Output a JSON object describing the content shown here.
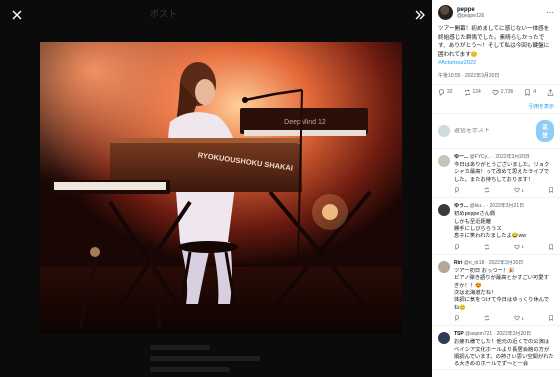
{
  "viewer": {
    "close_icon": "close-icon",
    "expand_icon": "chevron-double-right-icon",
    "ghost_tab_label": "ポスト"
  },
  "photo": {
    "banner_text": "RYOKUOUSHOKU SHAKAI",
    "keyboard_label": "DeepMind 12"
  },
  "post": {
    "display_name": "peppe",
    "handle": "@peppe126",
    "body": "ツアー開幕！初めましてに感じない一体感を終始感じた群馬でした。素晴らしかったです、ありがとう〜！そして私は今回も鍵盤に囲われてます😊",
    "hashtag": "#Actortour2022",
    "timestamp": "午後10:55 · 2022年3月20日",
    "stats": {
      "replies": "32",
      "reposts": "124",
      "likes": "2,736",
      "bookmarks": "4"
    },
    "related_link": "引用を表示"
  },
  "reply_box": {
    "placeholder": "返信をポスト",
    "button_label": "返信"
  },
  "replies": [
    {
      "name": "ゆー...",
      "handle": "@FYCy...",
      "date": "· 2022年3月20日",
      "text": "今日はありがとうございました。リョクシャカ最高！って改めて思えたライブでした。またお待ちしております！",
      "actions": {
        "reply": "",
        "repost": "",
        "like": "1",
        "views": ""
      },
      "avatar_color": "#c9c2b8"
    },
    {
      "name": "ゆう...",
      "handle": "@kiu...",
      "date": "· 2022年3月21日",
      "text": "初めpeppeさん側\nしかも至近距離\n勝手にしびららうス\n息子に笑われたましたよ😂ww",
      "actions": {
        "reply": "",
        "repost": "",
        "like": "1",
        "views": ""
      },
      "avatar_color": "#3d3a36"
    },
    {
      "name": "Riri",
      "handle": "@ri_rir18",
      "date": "· 2022年3月20日",
      "text": "ツアー初日 おっつー！🎉\nピアノ弾き語りが最高とかすごい可愛すぎか！！😍\n次は北海道だね！\n体調に気をつけて今日はゆっくり休んでね😊",
      "actions": {
        "reply": "",
        "repost": "",
        "like": "1",
        "views": ""
      },
      "avatar_color": "#b6a79b"
    },
    {
      "name": "TSP",
      "handle": "@aspon721",
      "date": "· 2022年3月20日",
      "text": "お疲れ様でした！他元の近くでの公演はベイシア文化ホールより長居会館の方が順調んでいます。の熱さい思い空間がれたる大きめのホールでず～と一会",
      "actions": {
        "reply": "",
        "repost": "",
        "like": "",
        "views": ""
      },
      "avatar_color": "#2f3b52"
    }
  ]
}
